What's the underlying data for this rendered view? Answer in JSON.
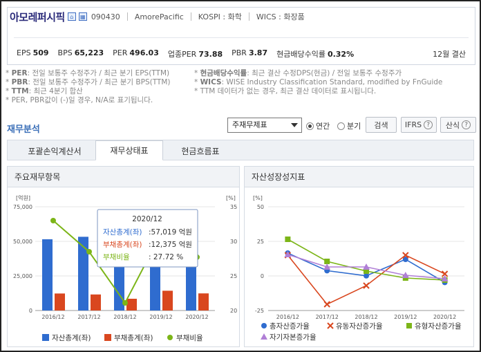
{
  "header": {
    "company": "아모레퍼시픽",
    "code": "090430",
    "english_name": "AmorePacific",
    "market": "KOSPI : 화학",
    "wics": "WICS : 화장품",
    "home_icon": "home-icon",
    "chart_icon": "building-icon"
  },
  "metrics": [
    {
      "label": "EPS",
      "value": "509"
    },
    {
      "label": "BPS",
      "value": "65,223"
    },
    {
      "label": "PER",
      "value": "496.03"
    },
    {
      "label": "업종PER",
      "value": "73.88"
    },
    {
      "label": "PBR",
      "value": "3.87"
    },
    {
      "label": "현금배당수익률",
      "value": "0.32%"
    }
  ],
  "fiscal_label": "12월 결산",
  "notes_left": [
    {
      "key": "PER",
      "text": ": 전일 보통주 수정주가 / 최근 분기 EPS(TTM)"
    },
    {
      "key": "PBR",
      "text": ": 전일 보통주 수정주가 / 최근 분기 BPS(TTM)"
    },
    {
      "key": "TTM",
      "text": ": 최근 4분기 합산"
    },
    {
      "key": "",
      "text": "PER, PBR값이 (-)일 경우, N/A로 표기됩니다."
    }
  ],
  "notes_right": [
    {
      "key": "현금배당수익률",
      "text": ": 최근 결산 수정DPS(현금) / 전일 보통주 수정주가"
    },
    {
      "key": "WICS",
      "text": ": WISE Industry Classification Standard, modified by FnGuide"
    },
    {
      "key": "",
      "text": "TTM 데이터가 없는 경우, 최근 결산 데이터로 표시됩니다."
    }
  ],
  "controls": {
    "section_title": "재무분석",
    "select_value": "주재무제표",
    "radio_annual": "연간",
    "radio_quarter": "분기",
    "search_button": "검색",
    "ifrs_button": "IFRS",
    "formula_button": "산식"
  },
  "tabs": [
    {
      "label": "포괄손익계산서",
      "active": false
    },
    {
      "label": "재무상태표",
      "active": true
    },
    {
      "label": "현금흐름표",
      "active": false
    }
  ],
  "left_panel": {
    "title": "주요재무항목",
    "tooltip": {
      "period": "2020/12",
      "rows": [
        {
          "label": "자산총계(좌)",
          "value": ":57,019 억원",
          "color": "#2f6ccf"
        },
        {
          "label": "부채총계(좌)",
          "value": ":12,375 억원",
          "color": "#d9471f"
        },
        {
          "label": "부채비율",
          "value": ":     27.72 %",
          "color": "#7cb518"
        }
      ]
    }
  },
  "right_panel": {
    "title": "자산성장성지표"
  },
  "chart_data": [
    {
      "type": "bar",
      "categories": [
        "2016/12",
        "2017/12",
        "2018/12",
        "2019/12",
        "2020/12"
      ],
      "series": [
        {
          "name": "자산총계(좌)",
          "kind": "bar",
          "axis": "left",
          "color": "#2f6ccf",
          "values": [
            51500,
            53300,
            52900,
            55100,
            57019
          ]
        },
        {
          "name": "부채총계(좌)",
          "kind": "bar",
          "axis": "left",
          "color": "#d9471f",
          "values": [
            12300,
            11600,
            8500,
            14300,
            12375
          ]
        },
        {
          "name": "부채비율",
          "kind": "line",
          "axis": "right",
          "color": "#7cb518",
          "values": [
            33.0,
            28.5,
            21.1,
            31.1,
            27.72
          ]
        }
      ],
      "left_axis": {
        "unit": "[억원]",
        "ylim": [
          0,
          75000
        ],
        "ticks": [
          "0",
          "25,000",
          "50,000",
          "75,000"
        ]
      },
      "right_axis": {
        "unit": "[%]",
        "ylim": [
          20,
          35
        ],
        "ticks": [
          "20",
          "25",
          "30",
          "35"
        ]
      },
      "legend": "bottom"
    },
    {
      "type": "line",
      "categories": [
        "2016/12",
        "2017/12",
        "2018/12",
        "2019/12",
        "2020/12"
      ],
      "series": [
        {
          "name": "총자산증가율",
          "color": "#2f6ccf",
          "marker": "circle",
          "values": [
            16.5,
            3.8,
            0.1,
            12.0,
            -4.7
          ]
        },
        {
          "name": "유동자산증가율",
          "color": "#d9471f",
          "marker": "x",
          "values": [
            15.0,
            -20.5,
            -7.0,
            15.0,
            1.5
          ]
        },
        {
          "name": "유형자산증가율",
          "color": "#7cb518",
          "marker": "square",
          "values": [
            26.5,
            10.5,
            3.5,
            -1.5,
            -3.0
          ]
        },
        {
          "name": "자기자본증가율",
          "color": "#b07fd6",
          "marker": "triangle",
          "values": [
            15.5,
            6.5,
            6.5,
            0.5,
            -2.0
          ]
        }
      ],
      "y_axis": {
        "unit": "[%]",
        "ylim": [
          -25,
          50
        ],
        "ticks": [
          "-25",
          "0",
          "25",
          "50"
        ]
      },
      "legend": "bottom"
    }
  ]
}
